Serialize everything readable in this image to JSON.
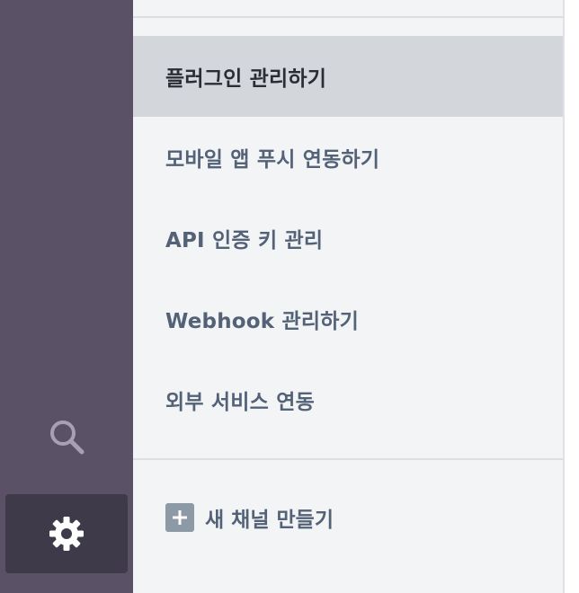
{
  "rail": {
    "search_icon": "search-icon",
    "settings_icon": "gear-icon"
  },
  "menu": {
    "items": [
      {
        "label": "플러그인 관리하기",
        "active": true
      },
      {
        "label": "모바일 앱 푸시 연동하기",
        "active": false
      },
      {
        "label": "API 인증 키 관리",
        "active": false
      },
      {
        "label": "Webhook 관리하기",
        "active": false
      },
      {
        "label": "외부 서비스 연동",
        "active": false
      }
    ]
  },
  "new_channel": {
    "label": "새 채널 만들기",
    "icon": "plus-icon"
  },
  "colors": {
    "rail_bg": "#5b5167",
    "rail_active_bg": "#3f3a4a",
    "panel_bg": "#f3f4f6",
    "active_item_bg": "#d3d7dc",
    "menu_text": "#546278",
    "active_text": "#2a2d33"
  }
}
